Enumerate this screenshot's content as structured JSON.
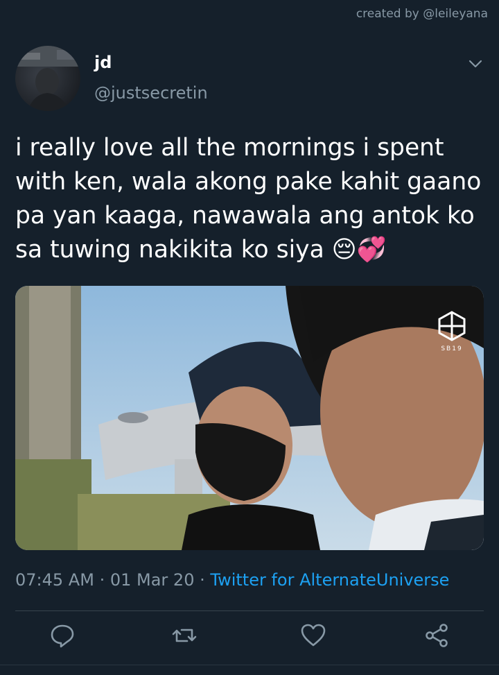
{
  "credit": "created by @leileyana",
  "tweet": {
    "author_name": "jd",
    "author_handle": "@justsecretin",
    "text": "i really love all the mornings i spent with ken, wala akong pake kahit gaano pa yan kaaga, nawawala ang antok ko sa tuwing nakikita ko siya 😔💞",
    "time": "07:45 AM",
    "separator": "·",
    "date": "01 Mar 20",
    "source": "Twitter for AlternateUniverse",
    "media_watermark": "SB19"
  },
  "actions": [
    {
      "name": "reply",
      "icon": "reply-icon"
    },
    {
      "name": "retweet",
      "icon": "retweet-icon"
    },
    {
      "name": "like",
      "icon": "heart-icon"
    },
    {
      "name": "share",
      "icon": "share-icon"
    }
  ],
  "colors": {
    "background": "#15202b",
    "secondary_text": "#8899a6",
    "link": "#1da1f2",
    "divider": "#38444d"
  }
}
